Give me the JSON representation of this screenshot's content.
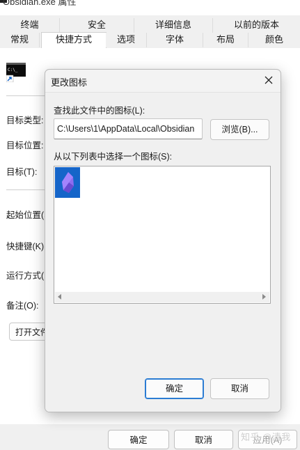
{
  "window": {
    "title": "Obsidian.exe 属性"
  },
  "tabs_row1": [
    "终端",
    "安全",
    "详细信息",
    "以前的版本"
  ],
  "tabs_row2": [
    "常规",
    "快捷方式",
    "选项",
    "字体",
    "布局",
    "颜色"
  ],
  "active_tab": "快捷方式",
  "properties": {
    "target_type_label": "目标类型:",
    "target_location_label": "目标位置:",
    "target_label": "目标(T):",
    "start_in_label": "起始位置(S",
    "shortcut_key_label": "快捷键(K):",
    "run_label": "运行方式(R",
    "comment_label": "备注(O):",
    "open_location_button": "打开文件"
  },
  "bottom_buttons": {
    "ok": "确定",
    "cancel": "取消",
    "apply": "应用(A)"
  },
  "watermark": "知乎 @清我",
  "dialog": {
    "title": "更改图标",
    "find_label": "查找此文件中的图标(L):",
    "path_value": "C:\\Users\\1\\AppData\\Local\\Obsidian",
    "browse_button": "浏览(B)...",
    "select_label": "从以下列表中选择一个图标(S):",
    "ok_button": "确定",
    "cancel_button": "取消"
  },
  "colors": {
    "accent": "#2b7cd3",
    "icon_tile": "#1565c9",
    "icon_gem": "#8e6cf0"
  }
}
